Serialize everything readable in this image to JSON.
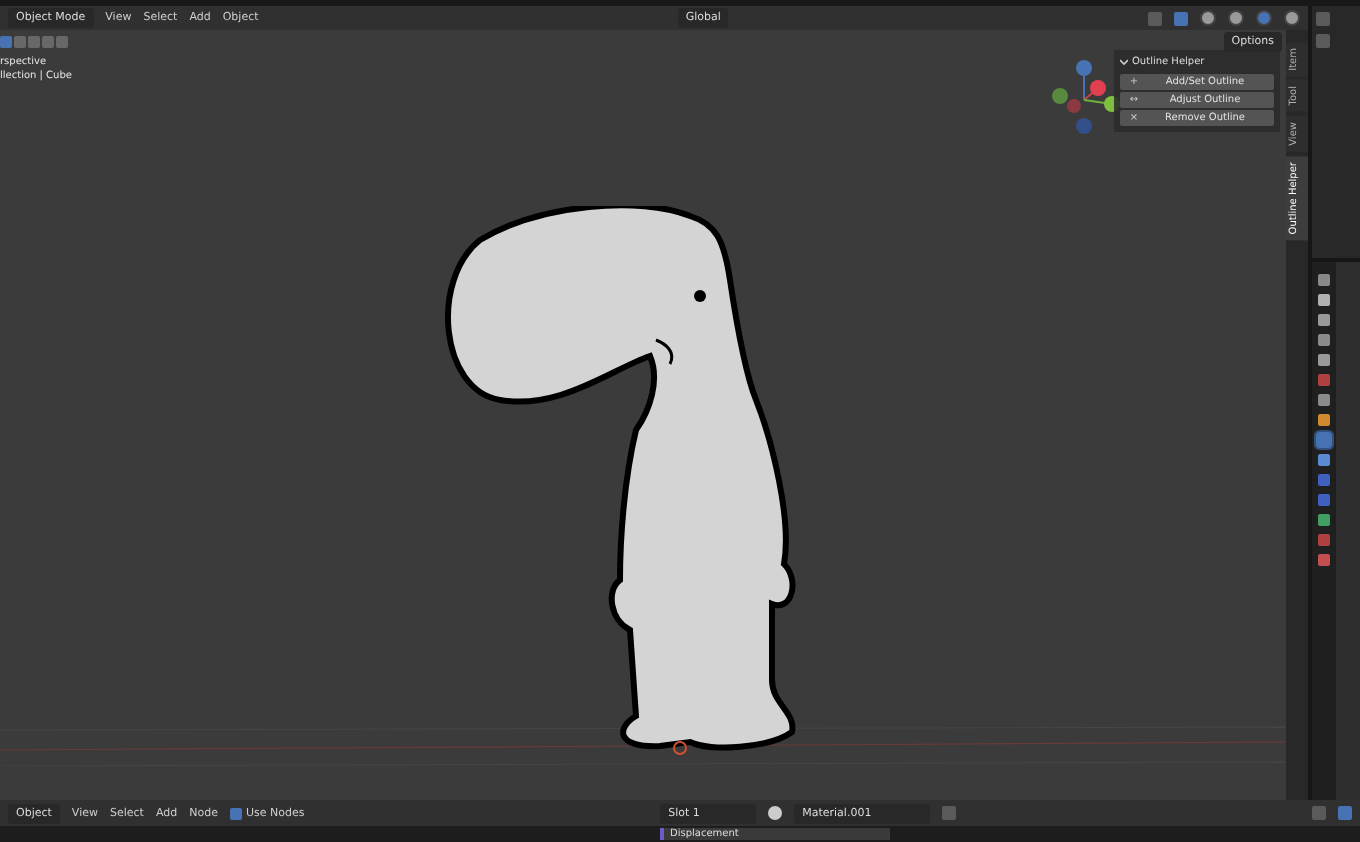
{
  "viewport_header": {
    "mode": "Object Mode",
    "menus": [
      "View",
      "Select",
      "Add",
      "Object"
    ],
    "orientation": "Global",
    "options": "Options"
  },
  "shading_modes": [
    {
      "selected": false
    },
    {
      "selected": false
    },
    {
      "selected": true
    },
    {
      "selected": false
    }
  ],
  "overlay_text": [
    "rspective",
    "llection | Cube"
  ],
  "outline_helper": {
    "title": "Outline Helper",
    "expanded": true,
    "buttons": [
      {
        "icon": "+",
        "label": "Add/Set Outline"
      },
      {
        "icon": "↔",
        "label": "Adjust Outline"
      },
      {
        "icon": "×",
        "label": "Remove Outline"
      }
    ]
  },
  "sidebar_tabs": [
    {
      "label": "Item",
      "selected": false
    },
    {
      "label": "Tool",
      "selected": false
    },
    {
      "label": "View",
      "selected": false
    },
    {
      "label": "Outline Helper",
      "selected": true
    }
  ],
  "properties_tabs": [
    {
      "selected": false
    },
    {
      "selected": false
    },
    {
      "selected": false
    },
    {
      "selected": false
    },
    {
      "selected": false
    },
    {
      "selected": false
    },
    {
      "selected": false
    },
    {
      "selected": false
    },
    {
      "selected": true
    },
    {
      "selected": false
    },
    {
      "selected": false
    },
    {
      "selected": false
    },
    {
      "selected": false
    },
    {
      "selected": false
    },
    {
      "selected": false
    }
  ],
  "shader_header": {
    "mode": "Object",
    "menus": [
      "View",
      "Select",
      "Add",
      "Node"
    ],
    "use_nodes": {
      "label": "Use Nodes",
      "checked": true
    },
    "slot": "Slot 1",
    "material": "Material.001"
  },
  "node_bar": {
    "label": "Displacement"
  }
}
